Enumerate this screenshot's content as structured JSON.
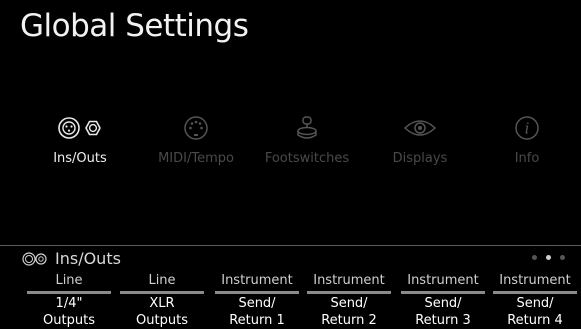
{
  "header": {
    "title": "Global Settings"
  },
  "categories": [
    {
      "label": "Ins/Outs",
      "icon": "ins-outs-icon",
      "active": true
    },
    {
      "label": "MIDI/Tempo",
      "icon": "midi-icon",
      "active": false
    },
    {
      "label": "Footswitches",
      "icon": "footswitch-icon",
      "active": false
    },
    {
      "label": "Displays",
      "icon": "eye-icon",
      "active": false
    },
    {
      "label": "Info",
      "icon": "info-icon",
      "active": false
    }
  ],
  "section": {
    "title": "Ins/Outs",
    "icon": "ins-outs-icon"
  },
  "pagination": {
    "dots": 3,
    "current": 2
  },
  "params": [
    {
      "value": "Line",
      "name_line1": "1/4\"",
      "name_line2": "Outputs"
    },
    {
      "value": "Line",
      "name_line1": "XLR",
      "name_line2": "Outputs"
    },
    {
      "value": "Instrument",
      "name_line1": "Send/",
      "name_line2": "Return 1"
    },
    {
      "value": "Instrument",
      "name_line1": "Send/",
      "name_line2": "Return 2"
    },
    {
      "value": "Instrument",
      "name_line1": "Send/",
      "name_line2": "Return 3"
    },
    {
      "value": "Instrument",
      "name_line1": "Send/",
      "name_line2": "Return 4"
    }
  ],
  "colors": {
    "background": "#000000",
    "active": "#ffffff",
    "inactive": "#4a4a4a",
    "bar": "#8a8a8a"
  }
}
